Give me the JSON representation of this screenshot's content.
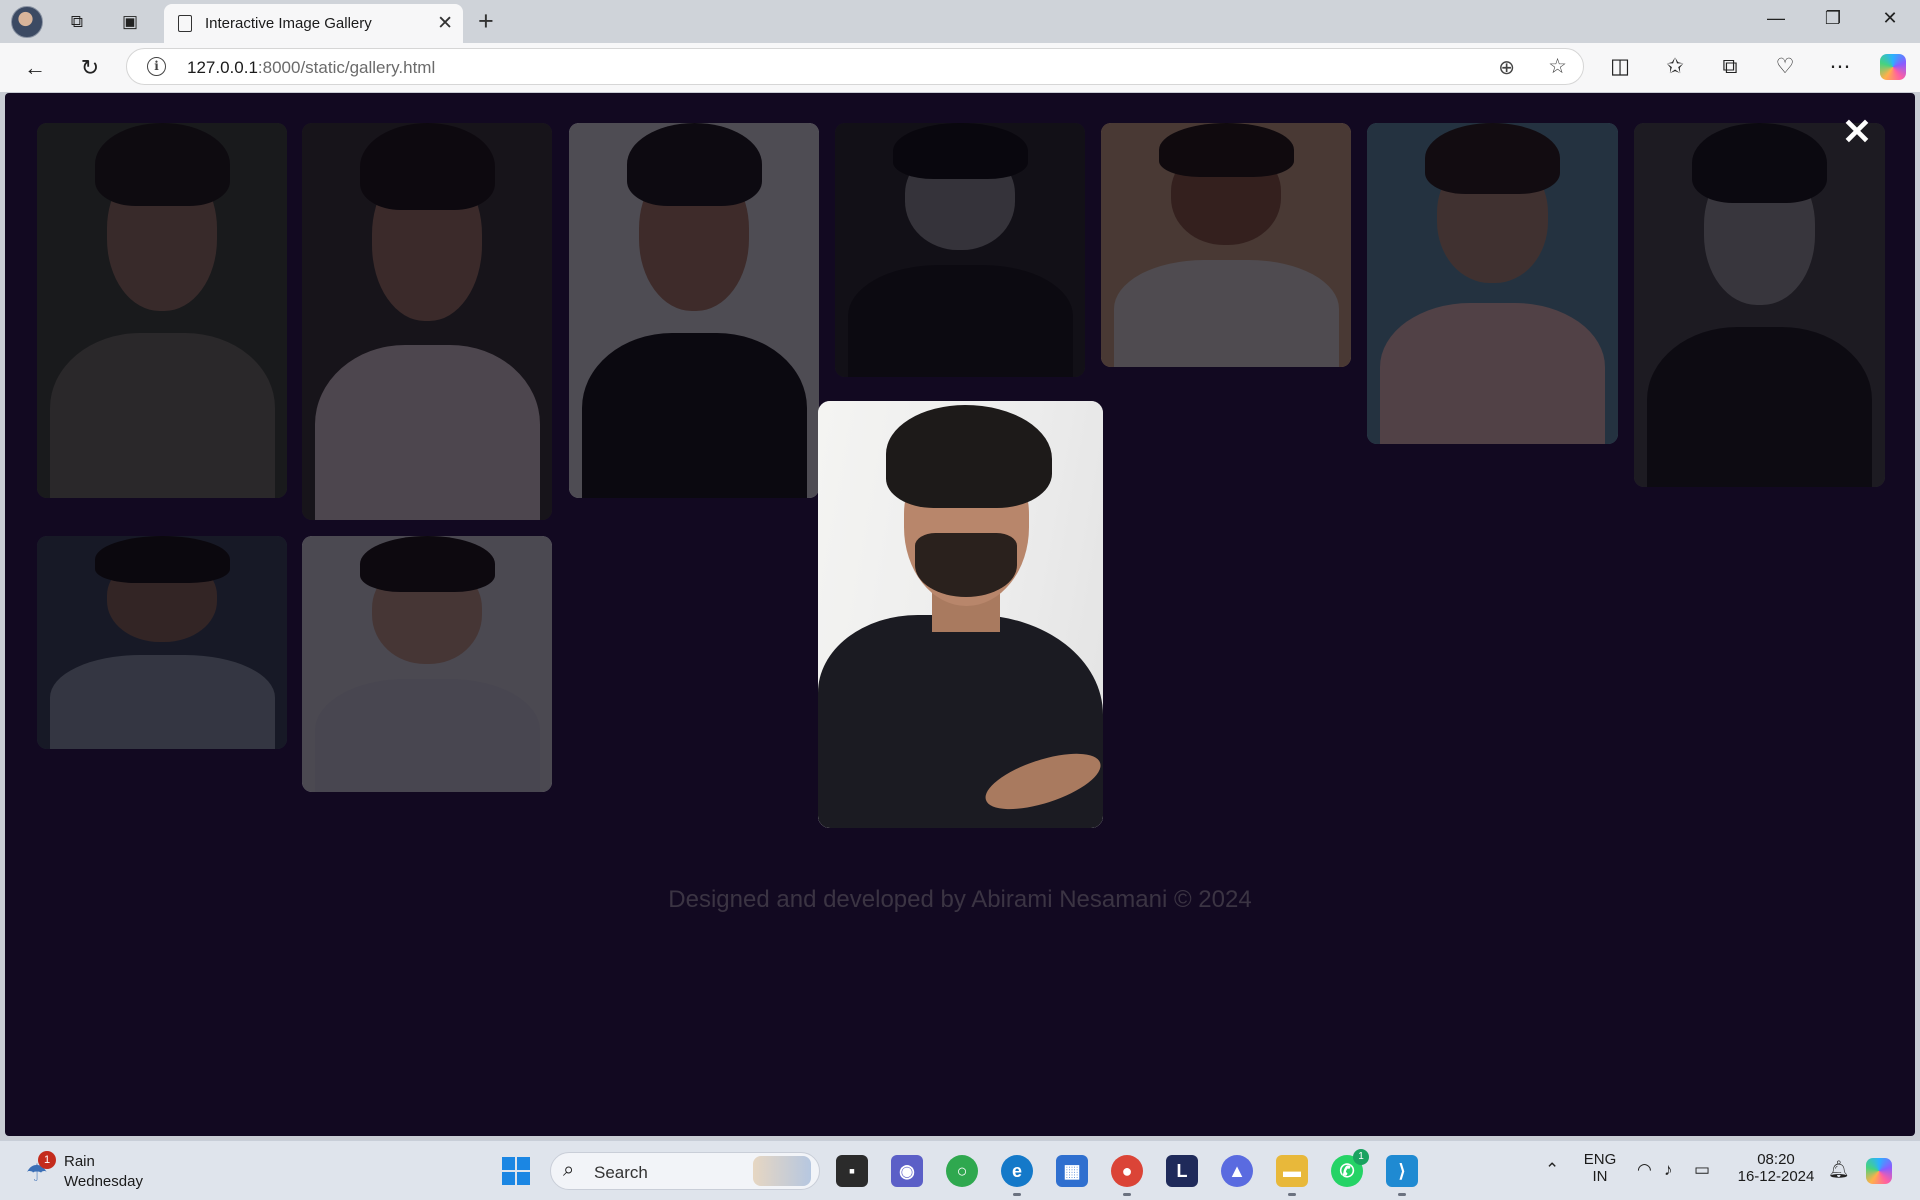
{
  "browser": {
    "tab_title": "Interactive Image Gallery",
    "url_host": "127.0.0.1",
    "url_path": ":8000/static/gallery.html"
  },
  "gallery": {
    "images": [
      {
        "name": "gallery-image-1",
        "bg": "#3e4638",
        "face": "#9a7762",
        "hair": "#1f1b17",
        "body": "#6f7060"
      },
      {
        "name": "gallery-image-2",
        "bg": "#3a3533",
        "face": "#a07762",
        "hair": "#1b1614",
        "body": "#d7c7c9"
      },
      {
        "name": "gallery-image-3",
        "bg": "#d9d9d9",
        "face": "#a97a62",
        "hair": "#1d1a19",
        "body": "#151515"
      },
      {
        "name": "gallery-image-4",
        "bg": "#2b2b2b",
        "face": "#8f8f8f",
        "hair": "#0f0f0f",
        "body": "#1a1a1a"
      },
      {
        "name": "gallery-image-5",
        "bg": "#c9a27e",
        "face": "#8c5a3f",
        "hair": "#231811",
        "body": "#dcd6cf"
      },
      {
        "name": "gallery-image-6",
        "bg": "#5f8ea0",
        "face": "#b08a72",
        "hair": "#2a1e18",
        "body": "#e1b9b3"
      },
      {
        "name": "gallery-image-7",
        "bg": "#4a4a4a",
        "face": "#9a9a9a",
        "hair": "#151515",
        "body": "#1c1c1c"
      },
      {
        "name": "gallery-image-8",
        "bg": "#384555",
        "face": "#8a6652",
        "hair": "#161311",
        "body": "#8c9aa6"
      },
      {
        "name": "gallery-image-9",
        "bg": "#cfcfd4",
        "face": "#c19a82",
        "hair": "#1b1512",
        "body": "#c8c8d0"
      }
    ]
  },
  "modal": {
    "close_label": "✕"
  },
  "footer": {
    "text": "Designed and developed by Abirami Nesamani © 2024"
  },
  "taskbar": {
    "weather_badge": "1",
    "weather_condition": "Rain",
    "weather_day": "Wednesday",
    "search_label": "Search",
    "whatsapp_badge": "1",
    "lang_line1": "ENG",
    "lang_line2": "IN",
    "time": "08:20",
    "date": "16-12-2024"
  }
}
